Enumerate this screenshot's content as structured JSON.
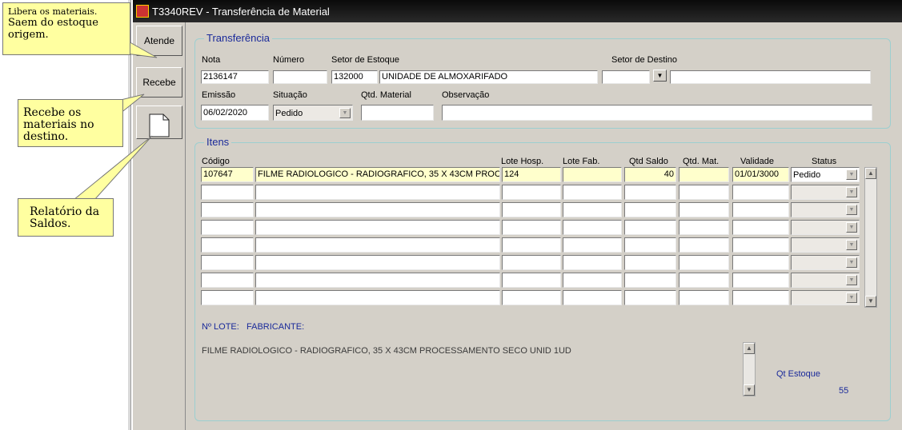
{
  "window": {
    "title": "T3340REV - Transferência de Material"
  },
  "sidebar": {
    "atende": "Atende",
    "recebe": "Recebe"
  },
  "notes": {
    "libera": "Libera os materiais.",
    "libera2": "Saem do estoque",
    "libera3": "origem.",
    "recebe": "Recebe os materiais no destino.",
    "relatorio": "Relatório da Saldos."
  },
  "transferencia": {
    "title": "Transferência",
    "labels": {
      "nota": "Nota",
      "numero": "Número",
      "setor_estoque": "Setor de Estoque",
      "setor_destino": "Setor de Destino",
      "emissao": "Emissão",
      "situacao": "Situação",
      "qtd_material": "Qtd. Material",
      "observacao": "Observação"
    },
    "values": {
      "nota": "2136147",
      "numero": "",
      "setor_estoque_cod": "132000",
      "setor_estoque_nome": "UNIDADE DE ALMOXARIFADO",
      "setor_destino_cod": "",
      "setor_destino_nome": "",
      "emissao": "06/02/2020",
      "situacao": "Pedido",
      "qtd_material": "",
      "observacao": ""
    }
  },
  "itens": {
    "title": "Itens",
    "headers": {
      "codigo": "Código",
      "lote_hosp": "Lote Hosp.",
      "lote_fab": "Lote Fab.",
      "qtd_saldo": "Qtd Saldo",
      "qtd_mat": "Qtd. Mat.",
      "validade": "Validade",
      "status": "Status"
    },
    "rows": [
      {
        "codigo": "107647",
        "descricao": "FILME RADIOLOGICO - RADIOGRAFICO, 35 X 43CM PROCESSAMENTO SECO UNID 1UD",
        "lote_hosp": "124",
        "lote_fab": "",
        "qtd_saldo": "40",
        "qtd_mat": "",
        "validade": "01/01/3000",
        "status": "Pedido"
      },
      {
        "codigo": "",
        "descricao": "",
        "lote_hosp": "",
        "lote_fab": "",
        "qtd_saldo": "",
        "qtd_mat": "",
        "validade": "",
        "status": ""
      },
      {
        "codigo": "",
        "descricao": "",
        "lote_hosp": "",
        "lote_fab": "",
        "qtd_saldo": "",
        "qtd_mat": "",
        "validade": "",
        "status": ""
      },
      {
        "codigo": "",
        "descricao": "",
        "lote_hosp": "",
        "lote_fab": "",
        "qtd_saldo": "",
        "qtd_mat": "",
        "validade": "",
        "status": ""
      },
      {
        "codigo": "",
        "descricao": "",
        "lote_hosp": "",
        "lote_fab": "",
        "qtd_saldo": "",
        "qtd_mat": "",
        "validade": "",
        "status": ""
      },
      {
        "codigo": "",
        "descricao": "",
        "lote_hosp": "",
        "lote_fab": "",
        "qtd_saldo": "",
        "qtd_mat": "",
        "validade": "",
        "status": ""
      },
      {
        "codigo": "",
        "descricao": "",
        "lote_hosp": "",
        "lote_fab": "",
        "qtd_saldo": "",
        "qtd_mat": "",
        "validade": "",
        "status": ""
      },
      {
        "codigo": "",
        "descricao": "",
        "lote_hosp": "",
        "lote_fab": "",
        "qtd_saldo": "",
        "qtd_mat": "",
        "validade": "",
        "status": ""
      }
    ],
    "lote_label": "Nº LOTE:",
    "fabricante_label": "FABRICANTE:",
    "descricao_full": "FILME RADIOLOGICO - RADIOGRAFICO, 35 X 43CM PROCESSAMENTO SECO UNID 1UD",
    "qt_estoque_label": "Qt Estoque",
    "qt_estoque_value": "55"
  },
  "colors": {
    "label_blue": "#1a2a9a",
    "frame_teal": "#9ccfd0",
    "field_yellow": "#ffffcc",
    "panel_gray": "#d4d0c8",
    "note_yellow": "#ffffa0"
  },
  "icons": [
    "app-icon",
    "document-icon",
    "dropdown-arrow-icon",
    "scroll-up-icon",
    "scroll-down-icon"
  ]
}
